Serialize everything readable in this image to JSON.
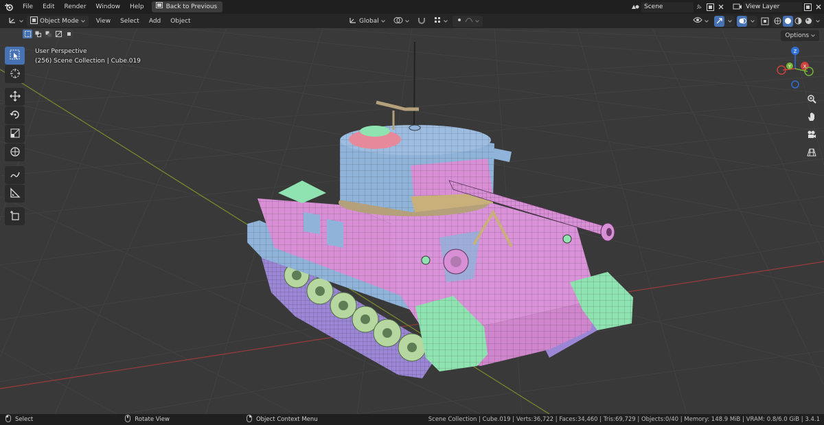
{
  "topbar": {
    "menus": [
      "File",
      "Edit",
      "Render",
      "Window",
      "Help"
    ],
    "back_button": "Back to Previous",
    "scene_name": "Scene",
    "view_layer_name": "View Layer"
  },
  "header": {
    "mode": "Object Mode",
    "menus": [
      "View",
      "Select",
      "Add",
      "Object"
    ],
    "transform_orientation": "Global",
    "options_label": "Options"
  },
  "viewport": {
    "perspective_label": "User Perspective",
    "collection_label": "(256) Scene Collection | Cube.019",
    "gizmo": {
      "x": "X",
      "y": "Y",
      "z": "Z"
    }
  },
  "statusbar": {
    "select": "Select",
    "rotate": "Rotate View",
    "context": "Object Context Menu",
    "info": "Scene Collection | Cube.019 | Verts:36,722 | Faces:34,460 | Tris:69,729 | Objects:0/40 | Memory: 148.9 MiB | VRAM: 0.8/6.0 GiB | 3.4.1"
  },
  "colors": {
    "accent": "#4772b3",
    "hull_pink": "#d98fd6",
    "turret_blue": "#8fb3d9",
    "track_purple": "#9b87d6",
    "fender_green": "#8fe3b0",
    "grid_x_axis": "#9c3a3a",
    "grid_y_axis": "#7c8c2c"
  },
  "icons": [
    "blender-logo-icon",
    "select-box-icon",
    "cursor-icon",
    "move-icon",
    "rotate-icon",
    "scale-icon",
    "transform-icon",
    "annotate-icon",
    "measure-icon",
    "add-cube-icon",
    "zoom-icon",
    "hand-pan-icon",
    "camera-icon",
    "grid-icon"
  ]
}
